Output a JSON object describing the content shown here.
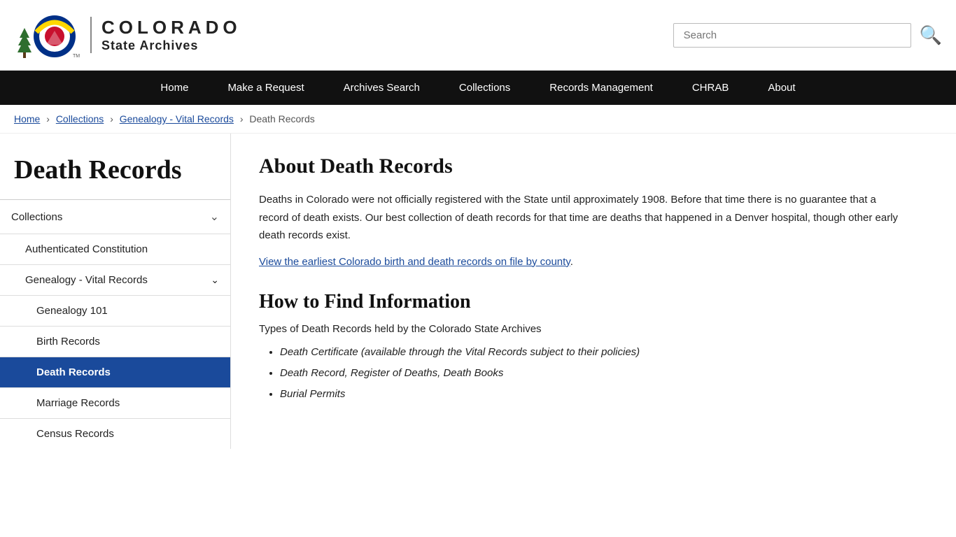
{
  "header": {
    "state_name": "COLORADO",
    "state_sub": "State Archives",
    "search_placeholder": "Search",
    "search_icon": "🔍"
  },
  "nav": {
    "items": [
      {
        "label": "Home",
        "id": "nav-home"
      },
      {
        "label": "Make a Request",
        "id": "nav-make-request"
      },
      {
        "label": "Archives Search",
        "id": "nav-archives-search"
      },
      {
        "label": "Collections",
        "id": "nav-collections"
      },
      {
        "label": "Records Management",
        "id": "nav-records-mgmt"
      },
      {
        "label": "CHRAB",
        "id": "nav-chrab"
      },
      {
        "label": "About",
        "id": "nav-about"
      }
    ]
  },
  "breadcrumb": {
    "items": [
      {
        "label": "Home",
        "link": true
      },
      {
        "label": "Collections",
        "link": true
      },
      {
        "label": "Genealogy - Vital Records",
        "link": true
      },
      {
        "label": "Death Records",
        "link": false
      }
    ]
  },
  "page_title": "Death Records",
  "sidebar": {
    "items": [
      {
        "label": "Collections",
        "expandable": true,
        "expanded": true,
        "children": [
          {
            "label": "Authenticated Constitution",
            "active": false,
            "indent": 1
          },
          {
            "label": "Genealogy - Vital Records",
            "expandable": true,
            "expanded": true,
            "indent": 1,
            "children": [
              {
                "label": "Genealogy 101",
                "active": false,
                "indent": 2
              },
              {
                "label": "Birth Records",
                "active": false,
                "indent": 2
              },
              {
                "label": "Death Records",
                "active": true,
                "indent": 2
              },
              {
                "label": "Marriage Records",
                "active": false,
                "indent": 2
              },
              {
                "label": "Census Records",
                "active": false,
                "indent": 2
              }
            ]
          }
        ]
      }
    ]
  },
  "main": {
    "section1_heading": "About Death Records",
    "section1_text": "Deaths in Colorado were not officially registered with the State until approximately 1908. Before that time there is no guarantee that a record of death exists. Our best collection of death records for that time are deaths that happened in a Denver hospital, though other early death records exist.",
    "section1_link": "View the earliest Colorado birth and death records on file by county",
    "section2_heading": "How to Find Information",
    "section2_sublabel": "Types of Death Records held by the Colorado State Archives",
    "bullet_items": [
      "Death Certificate (available through the Vital Records subject to their policies)",
      "Death Record, Register of Deaths, Death Books",
      "Burial Permits"
    ]
  }
}
